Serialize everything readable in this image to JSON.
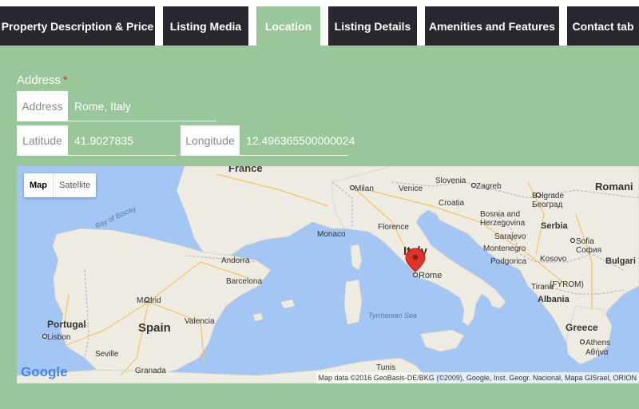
{
  "tabs": [
    {
      "label": "Property Description & Price"
    },
    {
      "label": "Listing Media"
    },
    {
      "label": "Location"
    },
    {
      "label": "Listing Details"
    },
    {
      "label": "Amenities and Features"
    },
    {
      "label": "Contact tab"
    }
  ],
  "address": {
    "label": "Address",
    "required_mark": "*",
    "prefix": "Address",
    "value": "Rome, Italy"
  },
  "latitude": {
    "prefix": "Latitude",
    "value": "41.9027835"
  },
  "longitude": {
    "prefix": "Longitude",
    "value": "12.496365500000024"
  },
  "map": {
    "type_map": "Map",
    "type_satellite": "Satellite",
    "logo": "Google",
    "attribution": "Map data ©2016 GeoBasis-DE/BKG (©2009), Google, Inst. Geogr. Nacional, Mapa GISrael, ORION",
    "places": {
      "france": "France",
      "bay_of_biscay": "Bay of Biscay",
      "andorra": "Andorra",
      "barcelona": "Barcelona",
      "madrid": "Madrid",
      "spain": "Spain",
      "portugal": "Portugal",
      "lisbon": "Lisbon",
      "valencia": "Valencia",
      "seville": "Seville",
      "granada": "Granada",
      "monaco": "Monaco",
      "milan": "Milan",
      "venice": "Venice",
      "florence": "Florence",
      "italy": "Italy",
      "rome": "Rome",
      "tyrrhenian": "Tyrrhenian Sea",
      "tunis": "Tunis",
      "slovenia": "Slovenia",
      "zagreb": "Zagreb",
      "croatia": "Croatia",
      "bosnia": "Bosnia and",
      "herzegovina": "Herzegovina",
      "sarajevo": "Sarajevo",
      "belgrade": "Belgrade",
      "belgrade_cyr": "Београд",
      "serbia": "Serbia",
      "montenegro": "Montenegro",
      "podgorica": "Podgorica",
      "kosovo": "Kosovo",
      "sofia": "Sofia",
      "sofia_cyr": "София",
      "bulgaria": "Bulgari",
      "tirana": "Tirana",
      "fyrom": "(FYROM)",
      "albania": "Albania",
      "greece": "Greece",
      "athens": "Athens",
      "athens_gr": "Αθήνα",
      "romania": "Romani"
    }
  },
  "colors": {
    "tab_bg": "#2b2730",
    "tab_active": "#99c799",
    "panel": "#99c799",
    "sea": "#a3c6f4",
    "land": "#eeebe2",
    "marker": "#e0342b"
  }
}
